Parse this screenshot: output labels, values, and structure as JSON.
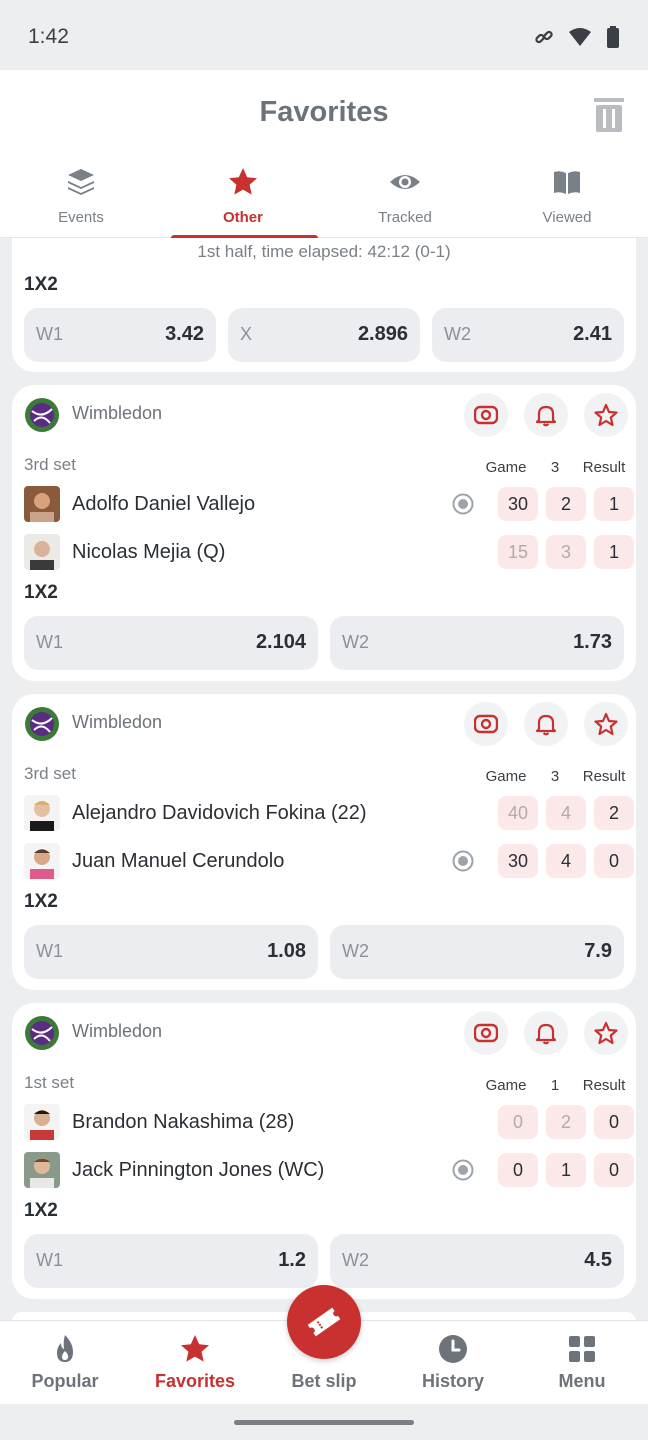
{
  "status_bar": {
    "time": "1:42",
    "icons": [
      "link-icon",
      "wifi-icon",
      "battery-icon"
    ]
  },
  "header": {
    "title": "Favorites",
    "tabs": [
      {
        "label": "Events",
        "icon": "layers-icon"
      },
      {
        "label": "Other",
        "icon": "star-icon",
        "active": true
      },
      {
        "label": "Tracked",
        "icon": "eye-icon"
      },
      {
        "label": "Viewed",
        "icon": "book-icon"
      }
    ]
  },
  "partial_match": {
    "status": "1st half, time elapsed: 42:12 (0-1)",
    "market": "1X2",
    "odds": [
      {
        "label": "W1",
        "value": "3.42"
      },
      {
        "label": "X",
        "value": "2.896"
      },
      {
        "label": "W2",
        "value": "2.41"
      }
    ]
  },
  "matches": [
    {
      "tournament": "Wimbledon",
      "set_label": "3rd set",
      "headers": {
        "game": "Game",
        "set": "3",
        "result": "Result"
      },
      "players": [
        {
          "name": "Adolfo Daniel Vallejo",
          "serving": true,
          "game": "30",
          "set": "2",
          "result": "1"
        },
        {
          "name": "Nicolas Mejia (Q)",
          "serving": false,
          "game": "15",
          "set": "3",
          "result": "1"
        }
      ],
      "market": "1X2",
      "odds": [
        {
          "label": "W1",
          "value": "2.104"
        },
        {
          "label": "W2",
          "value": "1.73"
        }
      ]
    },
    {
      "tournament": "Wimbledon",
      "set_label": "3rd set",
      "headers": {
        "game": "Game",
        "set": "3",
        "result": "Result"
      },
      "players": [
        {
          "name": "Alejandro Davidovich Fokina (22)",
          "serving": false,
          "game": "40",
          "set": "4",
          "result": "2"
        },
        {
          "name": "Juan Manuel Cerundolo",
          "serving": true,
          "game": "30",
          "set": "4",
          "result": "0"
        }
      ],
      "market": "1X2",
      "odds": [
        {
          "label": "W1",
          "value": "1.08"
        },
        {
          "label": "W2",
          "value": "7.9"
        }
      ]
    },
    {
      "tournament": "Wimbledon",
      "set_label": "1st set",
      "headers": {
        "game": "Game",
        "set": "1",
        "result": "Result"
      },
      "players": [
        {
          "name": "Brandon Nakashima (28)",
          "serving": false,
          "game": "0",
          "set": "2",
          "result": "0"
        },
        {
          "name": "Jack Pinnington Jones (WC)",
          "serving": true,
          "game": "0",
          "set": "1",
          "result": "0"
        }
      ],
      "market": "1X2",
      "odds": [
        {
          "label": "W1",
          "value": "1.2"
        },
        {
          "label": "W2",
          "value": "4.5"
        }
      ]
    }
  ],
  "bottom_nav": [
    {
      "label": "Popular",
      "icon": "flame-icon"
    },
    {
      "label": "Favorites",
      "icon": "star-icon",
      "active": true
    },
    {
      "label": "Bet slip",
      "icon": "ticket-icon"
    },
    {
      "label": "History",
      "icon": "clock-icon"
    },
    {
      "label": "Menu",
      "icon": "grid-icon"
    }
  ],
  "colors": {
    "accent": "#c8312f",
    "background": "#eceef0",
    "card": "#ffffff",
    "score_bg": "#fbe9e9"
  }
}
